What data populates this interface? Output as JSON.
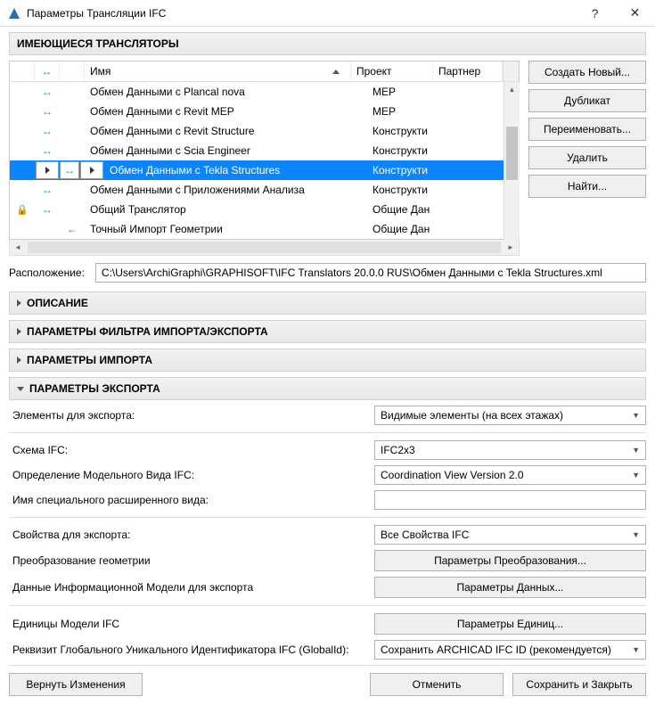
{
  "window": {
    "title": "Параметры Трансляции IFC"
  },
  "section_translators_title": "ИМЕЮЩИЕСЯ ТРАНСЛЯТОРЫ",
  "grid": {
    "headers": {
      "name": "Имя",
      "project": "Проект",
      "partner": "Партнер"
    },
    "rows": [
      {
        "dir1": "↔",
        "dir2": "",
        "name": "Обмен Данными с Plancal nova",
        "project": "MEP",
        "partner": ""
      },
      {
        "dir1": "↔",
        "dir2": "",
        "name": "Обмен Данными с Revit MEP",
        "project": "MEP",
        "partner": ""
      },
      {
        "dir1": "↔",
        "dir2": "",
        "name": "Обмен Данными с Revit Structure",
        "project": "Конструкти",
        "partner": ""
      },
      {
        "dir1": "↔",
        "dir2": "",
        "name": "Обмен Данными с Scia Engineer",
        "project": "Конструкти",
        "partner": ""
      },
      {
        "dir1": "↔",
        "dir2": "",
        "name": "Обмен Данными с Tekla Structures",
        "project": "Конструкти",
        "partner": "",
        "selected": true
      },
      {
        "dir1": "↔",
        "dir2": "",
        "name": "Обмен Данными с Приложениями Анализа",
        "project": "Конструкти",
        "partner": ""
      },
      {
        "dir1": "↔",
        "dir2": "",
        "name": "Общий Транслятор",
        "project": "Общие Дан",
        "partner": "",
        "locked": true
      },
      {
        "dir1": "",
        "dir2": "←",
        "name": "Точный Импорт Геометрии",
        "project": "Общие Дан",
        "partner": ""
      }
    ]
  },
  "side_buttons": {
    "create": "Создать Новый...",
    "duplicate": "Дубликат",
    "rename": "Переименовать...",
    "delete": "Удалить",
    "find": "Найти..."
  },
  "location": {
    "label": "Расположение:",
    "value": "C:\\Users\\ArchiGraphi\\GRAPHISOFT\\IFC Translators 20.0.0 RUS\\Обмен Данными с Tekla Structures.xml"
  },
  "collapsed_sections": {
    "desc": "ОПИСАНИЕ",
    "filter": "ПАРАМЕТРЫ ФИЛЬТРА ИМПОРТА/ЭКСПОРТА",
    "import": "ПАРАМЕТРЫ ИМПОРТА"
  },
  "export_section": {
    "title": "ПАРАМЕТРЫ ЭКСПОРТА"
  },
  "export": {
    "elements_label": "Элементы для экспорта:",
    "elements_value": "Видимые элементы (на всех этажах)",
    "schema_label": "Схема IFC:",
    "schema_value": "IFC2x3",
    "mvd_label": "Определение Модельного Вида IFC:",
    "mvd_value": "Coordination View Version 2.0",
    "ext_view_label": "Имя специального расширенного вида:",
    "ext_view_value": "",
    "props_label": "Свойства для экспорта:",
    "props_value": "Все Свойства IFC",
    "geom_label": "Преобразование геометрии",
    "geom_btn": "Параметры Преобразования...",
    "bim_label": "Данные Информационной Модели для экспорта",
    "bim_btn": "Параметры Данных...",
    "units_label": "Единицы Модели IFC",
    "units_btn": "Параметры Единиц...",
    "guid_label": "Реквизит Глобального Уникального Идентификатора IFC (GlobalId):",
    "guid_value": "Сохранить ARCHICAD IFC ID (рекомендуется)"
  },
  "bottom": {
    "revert": "Вернуть Изменения",
    "cancel": "Отменить",
    "save": "Сохранить и Закрыть"
  }
}
